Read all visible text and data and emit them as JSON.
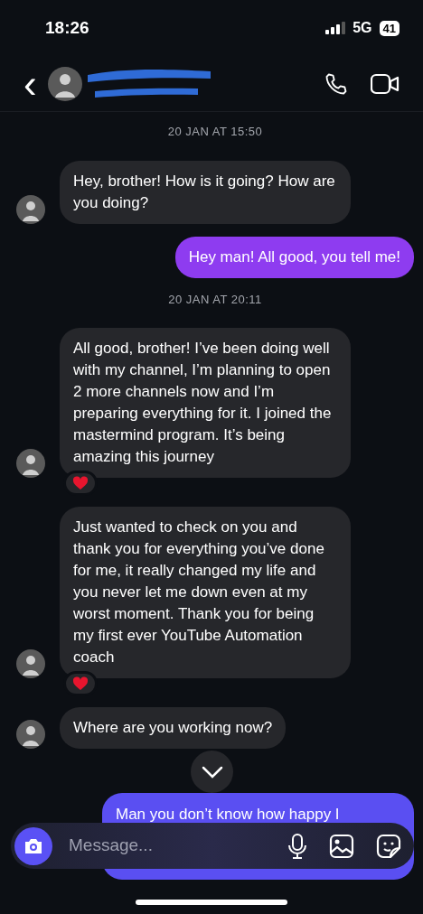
{
  "status_bar": {
    "time": "18:26",
    "network": "5G",
    "battery": "41"
  },
  "header": {
    "back": "‹"
  },
  "messages": [
    {
      "kind": "timestamp",
      "text": "20 JAN AT 15:50"
    },
    {
      "kind": "incoming",
      "text": "Hey, brother! How is it going? How are you doing?",
      "reacted": false
    },
    {
      "kind": "outgoing",
      "text": "Hey man! All good, you tell me!",
      "color": "#8e3cf0",
      "reacted": false
    },
    {
      "kind": "timestamp",
      "text": "20 JAN AT 20:11"
    },
    {
      "kind": "incoming",
      "text": "All good, brother! I’ve been doing well with my channel, I’m planning to open 2 more channels now and I’m preparing everything for it. I joined the mastermind program. It’s being amazing this journey",
      "reacted": true
    },
    {
      "kind": "incoming",
      "text": "Just wanted to check on you and thank you for everything you’ve done for me, it really changed my life and you never let me down even at my worst moment. Thank you for being my first ever YouTube Automation coach",
      "reacted": true
    },
    {
      "kind": "incoming",
      "text": "Where are you working now?",
      "reacted": false
    },
    {
      "kind": "outgoing",
      "text": "Man you don’t know how happy I",
      "color": "#5a4ff2",
      "reacted": false
    }
  ],
  "composer": {
    "placeholder": "Message..."
  }
}
